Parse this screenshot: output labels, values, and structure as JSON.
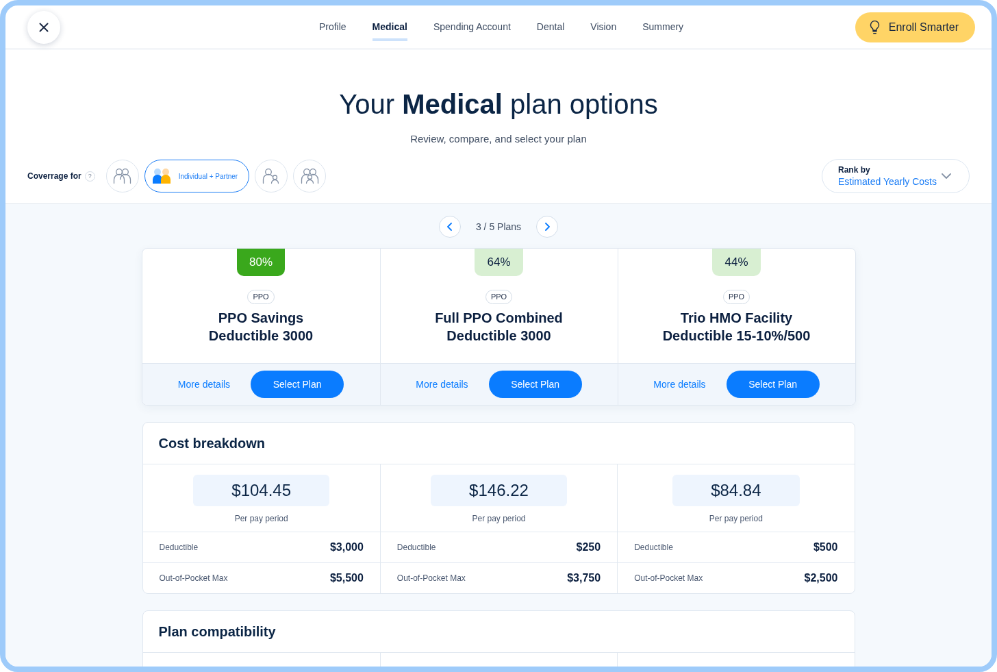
{
  "header": {
    "tabs": [
      {
        "label": "Profile",
        "selected": false
      },
      {
        "label": "Medical",
        "selected": true
      },
      {
        "label": "Spending Account",
        "selected": false
      },
      {
        "label": "Dental",
        "selected": false
      },
      {
        "label": "Vision",
        "selected": false
      },
      {
        "label": "Summery",
        "selected": false
      }
    ],
    "enroll_button": "Enroll Smarter"
  },
  "hero": {
    "title": "Your **Medical** plan options",
    "subtitle": "Review, compare, and select your plan"
  },
  "coverage": {
    "label": "Coverrage for",
    "help": "?",
    "options": [
      {
        "kind": "couple",
        "selected": false
      },
      {
        "kind": "couple",
        "selected": true,
        "label": "Individual + Partner"
      },
      {
        "kind": "parent-child",
        "selected": false
      },
      {
        "kind": "family",
        "selected": false
      }
    ]
  },
  "rank_by": {
    "label": "Rank by",
    "value": "Estimated Yearly Costs"
  },
  "pager": {
    "text": "3 / 5 Plans"
  },
  "plans": [
    {
      "match": "80%",
      "color": "#3aa81c",
      "type": "PPO",
      "name": "PPO Savings\nDeductible 3000",
      "details_link": "More details",
      "select_button": "Select Plan"
    },
    {
      "match": "64%",
      "color": "#d8efd2",
      "type": "PPO",
      "name": "Full PPO Combined\nDeductible 3000",
      "details_link": "More details",
      "select_button": "Select Plan"
    },
    {
      "match": "44%",
      "color": "#d8efd2",
      "type": "PPO",
      "name": "Trio HMO Facility\nDeductible 15-10%/500",
      "details_link": "More details",
      "select_button": "Select Plan"
    }
  ],
  "cost_breakdown": {
    "title": "Cost breakdown",
    "columns": [
      {
        "amount": "$104.45",
        "period": "Per pay period",
        "rows": [
          {
            "label": "Deductible",
            "value": "$3,000"
          },
          {
            "label": "Out-of-Pocket Max",
            "value": "$5,500"
          }
        ]
      },
      {
        "amount": "$146.22",
        "period": "Per pay period",
        "rows": [
          {
            "label": "Deductible",
            "value": "$250"
          },
          {
            "label": "Out-of-Pocket Max",
            "value": "$3,750"
          }
        ]
      },
      {
        "amount": "$84.84",
        "period": "Per pay period",
        "rows": [
          {
            "label": "Deductible",
            "value": "$500"
          },
          {
            "label": "Out-of-Pocket Max",
            "value": "$2,500"
          }
        ]
      }
    ]
  },
  "plan_compatibility": {
    "title": "Plan compatibility"
  }
}
